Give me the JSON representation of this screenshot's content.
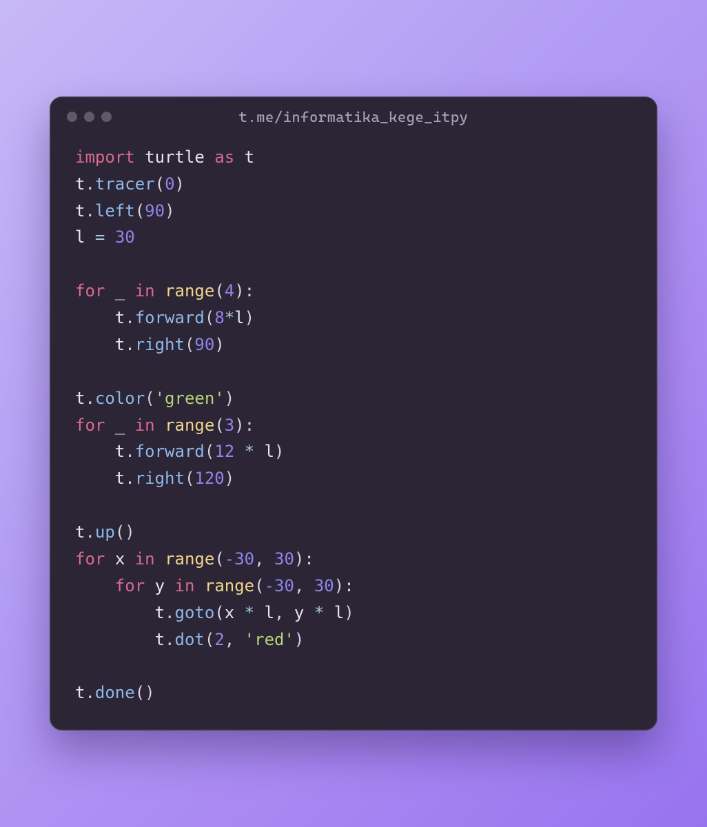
{
  "window": {
    "title": "t.me/informatika_kege_itpy"
  },
  "code": {
    "kw_import": "import",
    "mod": "turtle",
    "kw_as": "as",
    "alias": "t",
    "fn_tracer": "tracer",
    "n_tracer": "0",
    "fn_left": "left",
    "n_left": "90",
    "var_l": "l",
    "eq": "=",
    "n_l": "30",
    "kw_for": "for",
    "under": "_",
    "kw_in": "in",
    "bi_range": "range",
    "n_r1": "4",
    "fn_forward": "forward",
    "n_fwd1a": "8",
    "star": "*",
    "fn_right": "right",
    "n_right1": "90",
    "fn_color": "color",
    "str_green": "'green'",
    "n_r2": "3",
    "n_fwd2": "12",
    "n_right2": "120",
    "fn_up": "up",
    "var_x": "x",
    "n_r3a": "-30",
    "n_r3b": "30",
    "var_y": "y",
    "n_r4a": "-30",
    "n_r4b": "30",
    "fn_goto": "goto",
    "fn_dot": "dot",
    "n_dot": "2",
    "str_red": "'red'",
    "fn_done": "done",
    "comma": ",",
    "colon": ":",
    "lpar": "(",
    "rpar": ")",
    "dot": "."
  }
}
